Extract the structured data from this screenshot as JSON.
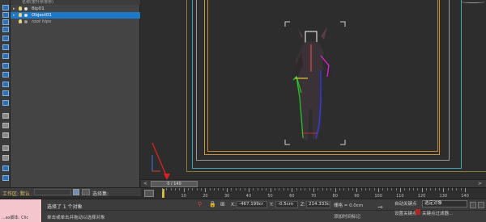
{
  "explorer": {
    "header": "名称(按升序排序)",
    "items": [
      {
        "label": "Bip01",
        "italic": false,
        "selected": false
      },
      {
        "label": "Object01",
        "italic": false,
        "selected": true
      },
      {
        "label": "root hips",
        "italic": true,
        "selected": false
      }
    ]
  },
  "toolbar": {
    "icons": [
      "select-icon",
      "select-icon",
      "link-icon",
      "link-icon",
      "move-icon",
      "rotate-icon",
      "scale-icon",
      "snap-icon",
      "snap-icon",
      "mirror-icon",
      "align-icon",
      "layer-icon",
      "layer-icon",
      "render-icon",
      "render-icon",
      "graph-icon",
      "filter-icon",
      "light-icon",
      "camera-icon"
    ]
  },
  "time_slider": {
    "label": "0 / 140",
    "prev": "<",
    "next": ">"
  },
  "workspace": {
    "label": "工作区: 默认",
    "selection_set": "选择集:"
  },
  "trackbar": {
    "ticks": [
      0,
      10,
      20,
      30,
      40,
      50,
      60,
      70,
      80,
      90,
      100,
      110,
      120,
      130,
      140
    ],
    "max_frame": 140,
    "current_frame": 0
  },
  "status": {
    "maxscript": "...ax脚本: Clic",
    "line1": "选择了 1 个对象",
    "line2": "单击或单击并拖动以选择对象",
    "coords": {
      "x_label": "X:",
      "x_value": "-467.199cr",
      "y_label": "Y:",
      "y_value": "-0.5cm",
      "z_label": "Z:",
      "z_value": "214.333cr"
    },
    "grid": "栅格 = 0.0cm",
    "add_time_tag": "添加时间标记",
    "auto_key": "自动关键点",
    "set_key": "设置关键点",
    "selected_object": "选定对象",
    "key_filters": "关键点过滤器..."
  }
}
